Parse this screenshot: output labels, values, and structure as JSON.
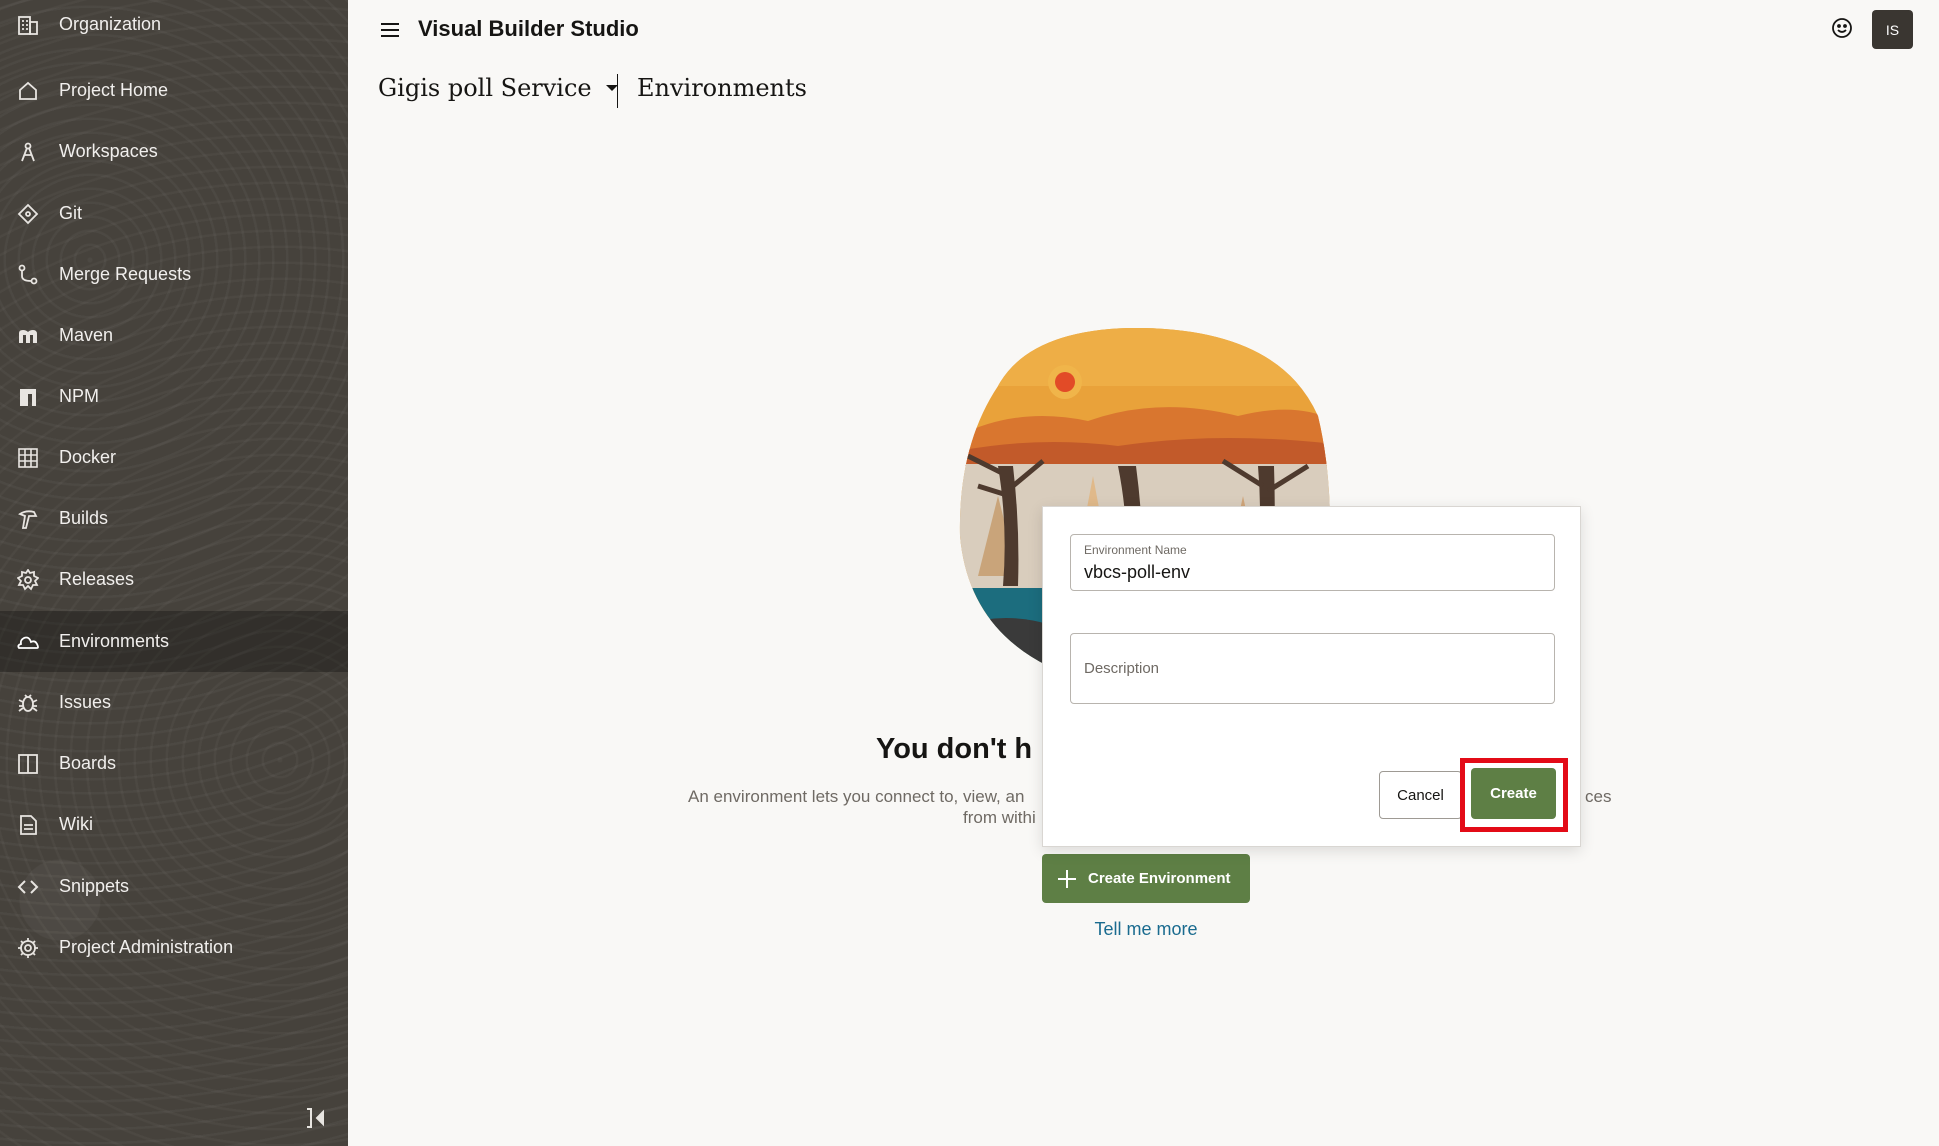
{
  "sidebar": {
    "items": [
      {
        "label": "Organization",
        "icon": "building-icon"
      },
      {
        "label": "Project Home",
        "icon": "home-icon"
      },
      {
        "label": "Workspaces",
        "icon": "compass-icon"
      },
      {
        "label": "Git",
        "icon": "git-icon"
      },
      {
        "label": "Merge Requests",
        "icon": "merge-icon"
      },
      {
        "label": "Maven",
        "icon": "maven-icon"
      },
      {
        "label": "NPM",
        "icon": "npm-icon"
      },
      {
        "label": "Docker",
        "icon": "docker-icon"
      },
      {
        "label": "Builds",
        "icon": "hammer-icon"
      },
      {
        "label": "Releases",
        "icon": "badge-icon"
      },
      {
        "label": "Environments",
        "icon": "cloud-icon",
        "active": true
      },
      {
        "label": "Issues",
        "icon": "bug-icon"
      },
      {
        "label": "Boards",
        "icon": "board-icon"
      },
      {
        "label": "Wiki",
        "icon": "document-icon"
      },
      {
        "label": "Snippets",
        "icon": "code-icon"
      },
      {
        "label": "Project Administration",
        "icon": "gear-icon"
      }
    ]
  },
  "header": {
    "app_title": "Visual Builder Studio",
    "avatar_initials": "IS",
    "project_name": "Gigis poll Service",
    "page_title": "Environments"
  },
  "empty_state": {
    "heading_visible": "You don't h",
    "desc_line1_left": "An environment lets you connect to, view, an",
    "desc_line1_right": "ces",
    "desc_line2_left": "from withi",
    "create_button": "Create Environment",
    "tell_more": "Tell me more"
  },
  "popup": {
    "name_label": "Environment Name",
    "name_value": "vbcs-poll-env",
    "description_placeholder": "Description",
    "cancel_label": "Cancel",
    "create_label": "Create"
  },
  "colors": {
    "sidebar_bg": "#46423c",
    "accent_green": "#5e7f45",
    "highlight_red": "#e30b17",
    "link_blue": "#1a6b8f"
  }
}
